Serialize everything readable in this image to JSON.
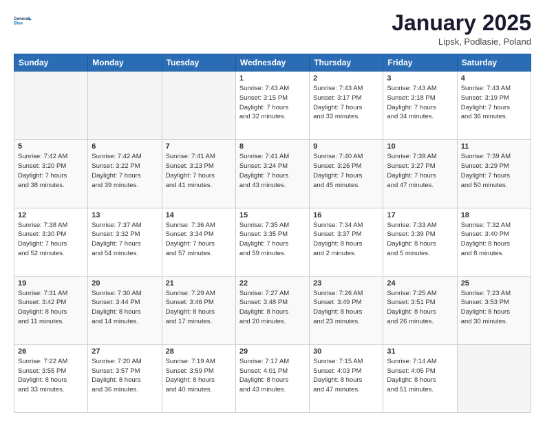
{
  "header": {
    "logo_line1": "General",
    "logo_line2": "Blue",
    "title": "January 2025",
    "subtitle": "Lipsk, Podlasie, Poland"
  },
  "days_of_week": [
    "Sunday",
    "Monday",
    "Tuesday",
    "Wednesday",
    "Thursday",
    "Friday",
    "Saturday"
  ],
  "weeks": [
    [
      {
        "day": "",
        "info": ""
      },
      {
        "day": "",
        "info": ""
      },
      {
        "day": "",
        "info": ""
      },
      {
        "day": "1",
        "info": "Sunrise: 7:43 AM\nSunset: 3:15 PM\nDaylight: 7 hours\nand 32 minutes."
      },
      {
        "day": "2",
        "info": "Sunrise: 7:43 AM\nSunset: 3:17 PM\nDaylight: 7 hours\nand 33 minutes."
      },
      {
        "day": "3",
        "info": "Sunrise: 7:43 AM\nSunset: 3:18 PM\nDaylight: 7 hours\nand 34 minutes."
      },
      {
        "day": "4",
        "info": "Sunrise: 7:43 AM\nSunset: 3:19 PM\nDaylight: 7 hours\nand 36 minutes."
      }
    ],
    [
      {
        "day": "5",
        "info": "Sunrise: 7:42 AM\nSunset: 3:20 PM\nDaylight: 7 hours\nand 38 minutes."
      },
      {
        "day": "6",
        "info": "Sunrise: 7:42 AM\nSunset: 3:22 PM\nDaylight: 7 hours\nand 39 minutes."
      },
      {
        "day": "7",
        "info": "Sunrise: 7:41 AM\nSunset: 3:23 PM\nDaylight: 7 hours\nand 41 minutes."
      },
      {
        "day": "8",
        "info": "Sunrise: 7:41 AM\nSunset: 3:24 PM\nDaylight: 7 hours\nand 43 minutes."
      },
      {
        "day": "9",
        "info": "Sunrise: 7:40 AM\nSunset: 3:26 PM\nDaylight: 7 hours\nand 45 minutes."
      },
      {
        "day": "10",
        "info": "Sunrise: 7:39 AM\nSunset: 3:27 PM\nDaylight: 7 hours\nand 47 minutes."
      },
      {
        "day": "11",
        "info": "Sunrise: 7:39 AM\nSunset: 3:29 PM\nDaylight: 7 hours\nand 50 minutes."
      }
    ],
    [
      {
        "day": "12",
        "info": "Sunrise: 7:38 AM\nSunset: 3:30 PM\nDaylight: 7 hours\nand 52 minutes."
      },
      {
        "day": "13",
        "info": "Sunrise: 7:37 AM\nSunset: 3:32 PM\nDaylight: 7 hours\nand 54 minutes."
      },
      {
        "day": "14",
        "info": "Sunrise: 7:36 AM\nSunset: 3:34 PM\nDaylight: 7 hours\nand 57 minutes."
      },
      {
        "day": "15",
        "info": "Sunrise: 7:35 AM\nSunset: 3:35 PM\nDaylight: 7 hours\nand 59 minutes."
      },
      {
        "day": "16",
        "info": "Sunrise: 7:34 AM\nSunset: 3:37 PM\nDaylight: 8 hours\nand 2 minutes."
      },
      {
        "day": "17",
        "info": "Sunrise: 7:33 AM\nSunset: 3:39 PM\nDaylight: 8 hours\nand 5 minutes."
      },
      {
        "day": "18",
        "info": "Sunrise: 7:32 AM\nSunset: 3:40 PM\nDaylight: 8 hours\nand 8 minutes."
      }
    ],
    [
      {
        "day": "19",
        "info": "Sunrise: 7:31 AM\nSunset: 3:42 PM\nDaylight: 8 hours\nand 11 minutes."
      },
      {
        "day": "20",
        "info": "Sunrise: 7:30 AM\nSunset: 3:44 PM\nDaylight: 8 hours\nand 14 minutes."
      },
      {
        "day": "21",
        "info": "Sunrise: 7:29 AM\nSunset: 3:46 PM\nDaylight: 8 hours\nand 17 minutes."
      },
      {
        "day": "22",
        "info": "Sunrise: 7:27 AM\nSunset: 3:48 PM\nDaylight: 8 hours\nand 20 minutes."
      },
      {
        "day": "23",
        "info": "Sunrise: 7:26 AM\nSunset: 3:49 PM\nDaylight: 8 hours\nand 23 minutes."
      },
      {
        "day": "24",
        "info": "Sunrise: 7:25 AM\nSunset: 3:51 PM\nDaylight: 8 hours\nand 26 minutes."
      },
      {
        "day": "25",
        "info": "Sunrise: 7:23 AM\nSunset: 3:53 PM\nDaylight: 8 hours\nand 30 minutes."
      }
    ],
    [
      {
        "day": "26",
        "info": "Sunrise: 7:22 AM\nSunset: 3:55 PM\nDaylight: 8 hours\nand 33 minutes."
      },
      {
        "day": "27",
        "info": "Sunrise: 7:20 AM\nSunset: 3:57 PM\nDaylight: 8 hours\nand 36 minutes."
      },
      {
        "day": "28",
        "info": "Sunrise: 7:19 AM\nSunset: 3:59 PM\nDaylight: 8 hours\nand 40 minutes."
      },
      {
        "day": "29",
        "info": "Sunrise: 7:17 AM\nSunset: 4:01 PM\nDaylight: 8 hours\nand 43 minutes."
      },
      {
        "day": "30",
        "info": "Sunrise: 7:15 AM\nSunset: 4:03 PM\nDaylight: 8 hours\nand 47 minutes."
      },
      {
        "day": "31",
        "info": "Sunrise: 7:14 AM\nSunset: 4:05 PM\nDaylight: 8 hours\nand 51 minutes."
      },
      {
        "day": "",
        "info": ""
      }
    ]
  ]
}
